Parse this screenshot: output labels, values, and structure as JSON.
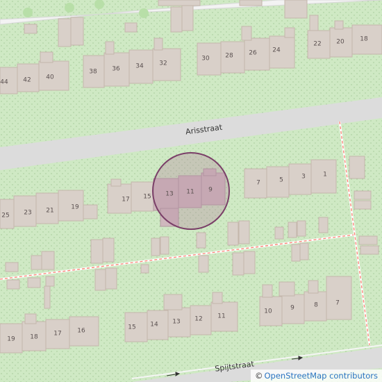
{
  "streets": {
    "arisstraat": "Arisstraat",
    "spijtstraat": "Spijtstraat"
  },
  "house_numbers": {
    "row1": [
      "44",
      "42",
      "40",
      "38",
      "36",
      "34",
      "32",
      "30",
      "28",
      "26",
      "24",
      "22",
      "20",
      "18"
    ],
    "row2": [
      "25",
      "23",
      "21",
      "19",
      "17",
      "15",
      "13",
      "11",
      "9",
      "7",
      "5",
      "3",
      "1"
    ],
    "row3": [
      "19",
      "18",
      "17",
      "16",
      "15",
      "14",
      "13",
      "12",
      "11",
      "10",
      "9",
      "8",
      "7"
    ]
  },
  "attribution": {
    "symbol": "©",
    "text": "OpenStreetMap contributors"
  },
  "colors": {
    "land": "#cfe9c4",
    "road": "#dcdcdc",
    "building": "#d9d0c9",
    "building_outline": "#c4b6ab",
    "path": "#fa8072",
    "highlight_fill": "#b58aa0",
    "highlight_stroke": "#7a3f68"
  }
}
